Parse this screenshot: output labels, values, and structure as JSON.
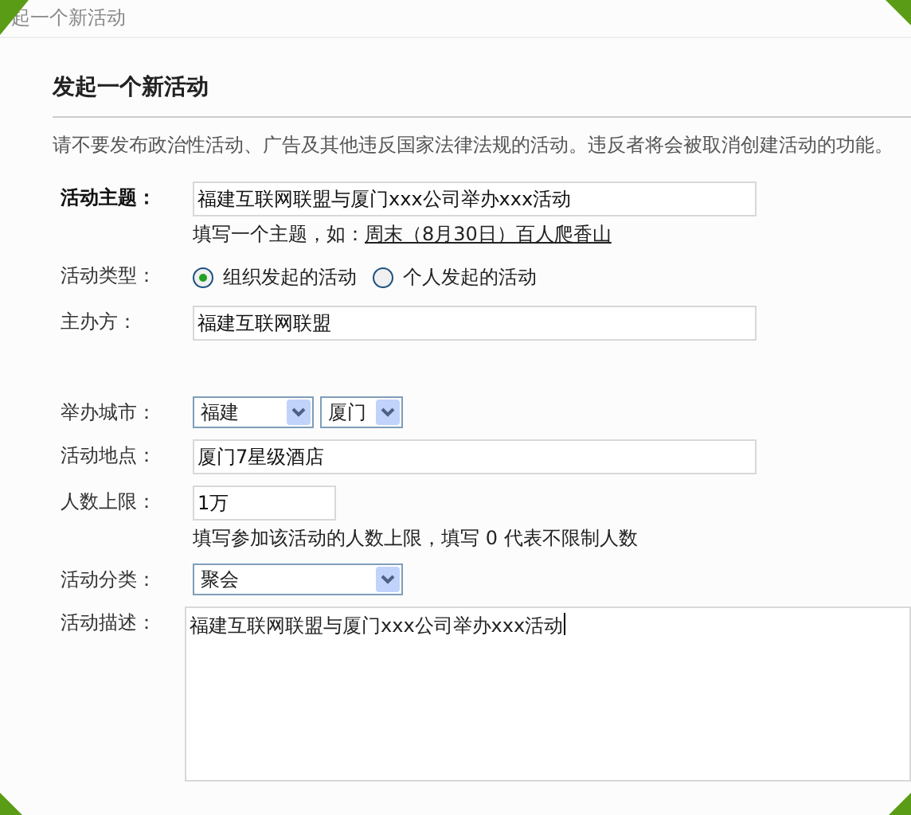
{
  "top_bar": {
    "title": "起一个新活动"
  },
  "heading": "发起一个新活动",
  "notice": "请不要发布政治性活动、广告及其他违反国家法律法规的活动。违反者将会被取消创建活动的功能。",
  "fields": [
    {
      "kind": "text",
      "label": "活动主题：",
      "bold": true,
      "value": "福建互联网联盟与厦门xxx公司举办xxx活动",
      "hint": "填写一个主题，如：",
      "hint_link": "周末（8月30日）百人爬香山"
    },
    {
      "kind": "radio",
      "label": "活动类型：",
      "options": [
        {
          "label": "组织发起的活动",
          "selected": true
        },
        {
          "label": "个人发起的活动",
          "selected": false
        }
      ]
    },
    {
      "kind": "text",
      "label": "主办方：",
      "value": "福建互联网联盟"
    },
    {
      "kind": "selects",
      "label": "举办城市：",
      "selects": [
        {
          "value": "福建"
        },
        {
          "value": "厦门"
        }
      ]
    },
    {
      "kind": "text",
      "label": "活动地点：",
      "value": "厦门7星级酒店"
    },
    {
      "kind": "short",
      "label": "人数上限：",
      "value": "1万",
      "hint": "填写参加该活动的人数上限，填写 0 代表不限制人数"
    },
    {
      "kind": "selects",
      "label": "活动分类：",
      "selects": [
        {
          "value": "聚会"
        }
      ]
    },
    {
      "kind": "textarea",
      "label": "活动描述：",
      "value": "福建互联网联盟与厦门xxx公司举办xxx活动"
    }
  ]
}
